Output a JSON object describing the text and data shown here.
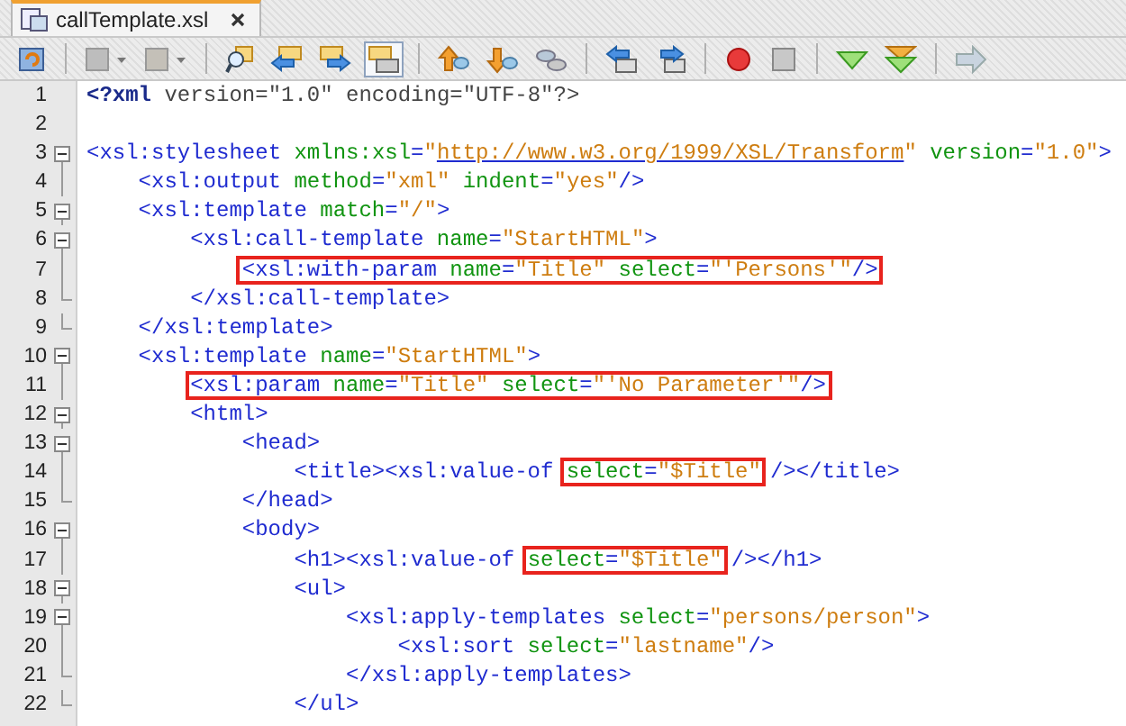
{
  "tabs": [
    {
      "label": "callTemplate.xsl",
      "selected": true
    }
  ],
  "editor": {
    "lines": [
      {
        "number": "1",
        "kind": "plain",
        "segments": [
          {
            "kind": "pi",
            "text": "<?xml"
          },
          {
            "kind": "pitext",
            "text": " version=\"1.0\" encoding=\"UTF-8\"?>"
          }
        ]
      },
      {
        "number": "2",
        "kind": "plain"
      },
      {
        "number": "3",
        "kind": "fold-start",
        "segments": [
          {
            "kind": "tag",
            "text": "<xsl:stylesheet"
          },
          {
            "kind": "attr",
            "text": " xmlns:xsl"
          },
          {
            "kind": "tag",
            "text": "="
          },
          {
            "kind": "value",
            "text": "\""
          },
          {
            "kind": "url",
            "text": "http://www.w3.org/1999/XSL/Transform"
          },
          {
            "kind": "value",
            "text": "\""
          },
          {
            "kind": "attr",
            "text": " version"
          },
          {
            "kind": "tag",
            "text": "="
          },
          {
            "kind": "value",
            "text": "\"1.0\""
          },
          {
            "kind": "tag",
            "text": ">"
          }
        ],
        "children": [
          {
            "number": "4",
            "kind": "fold-body",
            "segments": [
              {
                "kind": "tag",
                "text": "<xsl:output"
              },
              {
                "kind": "attr",
                "text": " method"
              },
              {
                "kind": "tag",
                "text": "="
              },
              {
                "kind": "value",
                "text": "\"xml\""
              },
              {
                "kind": "attr",
                "text": " indent"
              },
              {
                "kind": "tag",
                "text": "="
              },
              {
                "kind": "value",
                "text": "\"yes\""
              },
              {
                "kind": "tag",
                "text": "/>"
              }
            ]
          },
          {
            "number": "5",
            "kind": "fold-start",
            "segments": [
              {
                "kind": "tag",
                "text": "<xsl:template"
              },
              {
                "kind": "attr",
                "text": " match"
              },
              {
                "kind": "tag",
                "text": "="
              },
              {
                "kind": "value",
                "text": "\"/\""
              },
              {
                "kind": "tag",
                "text": ">"
              }
            ],
            "children": [
              {
                "number": "6",
                "kind": "fold-start",
                "segments": [
                  {
                    "kind": "tag",
                    "text": "<xsl:call-template"
                  },
                  {
                    "kind": "attr",
                    "text": " name"
                  },
                  {
                    "kind": "tag",
                    "text": "="
                  },
                  {
                    "kind": "value",
                    "text": "\"StartHTML\""
                  },
                  {
                    "kind": "tag",
                    "text": ">"
                  }
                ],
                "children": [
                  {
                    "number": "7",
                    "kind": "fold-body",
                    "segments": [
                      {
                        "kind": "box",
                        "tokens": [
                          {
                            "kind": "tag",
                            "text": "<xsl:with-param"
                          },
                          {
                            "kind": "attr",
                            "text": " name"
                          },
                          {
                            "kind": "tag",
                            "text": "="
                          },
                          {
                            "kind": "value",
                            "text": "\"Title\""
                          },
                          {
                            "kind": "attr",
                            "text": " select"
                          },
                          {
                            "kind": "tag",
                            "text": "="
                          },
                          {
                            "kind": "value",
                            "text": "\"'Persons'\""
                          },
                          {
                            "kind": "tag",
                            "text": "/>"
                          }
                        ]
                      }
                    ]
                  }
                ]
              },
              {
                "number": "8",
                "kind": "fold-end",
                "segments": [
                  {
                    "kind": "tag",
                    "text": "</xsl:call-template>"
                  }
                ]
              }
            ]
          },
          {
            "number": "9",
            "kind": "fold-end",
            "segments": [
              {
                "kind": "tag",
                "text": "</xsl:template>"
              }
            ]
          },
          {
            "number": "10",
            "kind": "fold-start",
            "segments": [
              {
                "kind": "tag",
                "text": "<xsl:template"
              },
              {
                "kind": "attr",
                "text": " name"
              },
              {
                "kind": "tag",
                "text": "="
              },
              {
                "kind": "value",
                "text": "\"StartHTML\""
              },
              {
                "kind": "tag",
                "text": ">"
              }
            ],
            "children": [
              {
                "number": "11",
                "kind": "fold-body",
                "segments": [
                  {
                    "kind": "box",
                    "tokens": [
                      {
                        "kind": "tag",
                        "text": "<xsl:param"
                      },
                      {
                        "kind": "attr",
                        "text": " name"
                      },
                      {
                        "kind": "tag",
                        "text": "="
                      },
                      {
                        "kind": "value",
                        "text": "\"Title\""
                      },
                      {
                        "kind": "attr",
                        "text": " select"
                      },
                      {
                        "kind": "tag",
                        "text": "="
                      },
                      {
                        "kind": "value",
                        "text": "\"'No Parameter'\""
                      },
                      {
                        "kind": "tag",
                        "text": "/>"
                      }
                    ]
                  }
                ]
              },
              {
                "number": "12",
                "kind": "fold-start",
                "segments": [
                  {
                    "kind": "tag",
                    "text": "<html>"
                  }
                ],
                "children": [
                  {
                    "number": "13",
                    "kind": "fold-start",
                    "segments": [
                      {
                        "kind": "tag",
                        "text": "<head>"
                      }
                    ],
                    "children": [
                      {
                        "number": "14",
                        "kind": "fold-body",
                        "segments": [
                          {
                            "kind": "tag",
                            "text": "<title><xsl:value-of "
                          },
                          {
                            "kind": "box",
                            "tokens": [
                              {
                                "kind": "attr",
                                "text": "select"
                              },
                              {
                                "kind": "tag",
                                "text": "="
                              },
                              {
                                "kind": "value",
                                "text": "\"$Title\""
                              }
                            ]
                          },
                          {
                            "kind": "tag",
                            "text": "/></title>"
                          }
                        ]
                      }
                    ]
                  },
                  {
                    "number": "15",
                    "kind": "fold-end",
                    "segments": [
                      {
                        "kind": "tag",
                        "text": "</head>"
                      }
                    ]
                  },
                  {
                    "number": "16",
                    "kind": "fold-start",
                    "segments": [
                      {
                        "kind": "tag",
                        "text": "<body>"
                      }
                    ],
                    "children": [
                      {
                        "number": "17",
                        "kind": "fold-body",
                        "segments": [
                          {
                            "kind": "tag",
                            "text": "<h1><xsl:value-of "
                          },
                          {
                            "kind": "box",
                            "tokens": [
                              {
                                "kind": "attr",
                                "text": "select"
                              },
                              {
                                "kind": "tag",
                                "text": "="
                              },
                              {
                                "kind": "value",
                                "text": "\"$Title\""
                              }
                            ]
                          },
                          {
                            "kind": "tag",
                            "text": "/></h1>"
                          }
                        ]
                      },
                      {
                        "number": "18",
                        "kind": "fold-start",
                        "segments": [
                          {
                            "kind": "tag",
                            "text": "<ul>"
                          }
                        ],
                        "children": [
                          {
                            "number": "19",
                            "kind": "fold-start",
                            "segments": [
                              {
                                "kind": "tag",
                                "text": "<xsl:apply-templates"
                              },
                              {
                                "kind": "attr",
                                "text": " select"
                              },
                              {
                                "kind": "tag",
                                "text": "="
                              },
                              {
                                "kind": "value",
                                "text": "\"persons/person\""
                              },
                              {
                                "kind": "tag",
                                "text": ">"
                              }
                            ],
                            "children": [
                              {
                                "number": "20",
                                "kind": "fold-body",
                                "segments": [
                                  {
                                    "kind": "tag",
                                    "text": "<xsl:sort"
                                  },
                                  {
                                    "kind": "attr",
                                    "text": " select"
                                  },
                                  {
                                    "kind": "tag",
                                    "text": "="
                                  },
                                  {
                                    "kind": "value",
                                    "text": "\"lastname\""
                                  },
                                  {
                                    "kind": "tag",
                                    "text": "/>"
                                  }
                                ]
                              }
                            ]
                          },
                          {
                            "number": "21",
                            "kind": "fold-end",
                            "segments": [
                              {
                                "kind": "tag",
                                "text": "</xsl:apply-templates>"
                              }
                            ]
                          }
                        ]
                      },
                      {
                        "number": "22",
                        "kind": "fold-end",
                        "segments": [
                          {
                            "kind": "tag",
                            "text": "</ul>"
                          }
                        ]
                      }
                    ]
                  }
                ]
              }
            ]
          }
        ]
      }
    ]
  }
}
